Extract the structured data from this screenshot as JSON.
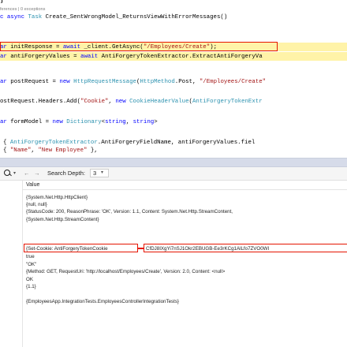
{
  "editor": {
    "top_fragment": "]",
    "codelens": "ferences | 0 exceptions",
    "lines": [
      "c async Task Create_SentWrongModel_ReturnsViewWithErrorMessages()",
      "ar initResponse = await _client.GetAsync(\"/Employees/Create\");",
      "ar antiForgeryValues = await AntiForgeryTokenExtractor.ExtractAntiForgeryVa",
      "ar postRequest = new HttpRequestMessage(HttpMethod.Post, \"/Employees/Create\"",
      "ostRequest.Headers.Add(\"Cookie\", new CookieHeaderValue(AntiForgeryTokenExtr",
      "ar formModel = new Dictionary<string, string>",
      "{ AntiForgeryTokenExtractor.AntiForgeryFieldName, antiForgeryValues.fiel",
      "{ \"Name\", \"New Employee\" },"
    ]
  },
  "watch": {
    "search_depth_label": "Search Depth:",
    "search_depth_value": "3",
    "column_header": "Value",
    "rows": [
      "{System.Net.Http.HttpClient}",
      "{null, null}",
      "{StatusCode: 200, ReasonPhrase: 'OK', Version: 1.1, Content: System.Net.Http.StreamContent,",
      "{System.Net.Http.StreamContent}",
      "{Set-Cookie: AntiForgeryTokenCookie",
      "true",
      "\"OK\"",
      "{Method: GET, RequestUri: 'http://localhost/Employees/Create', Version: 2.0, Content: <null>",
      "OK",
      "{1.1}",
      "",
      "{EmployeesApp.IntegrationTests.EmployeesControllerIntegrationTests}"
    ],
    "cookie_value": "CfDJ8IXgYi7nSJ1Okr2EBUGB-Ee3rKCg1AlLfo7ZVO0WI"
  }
}
